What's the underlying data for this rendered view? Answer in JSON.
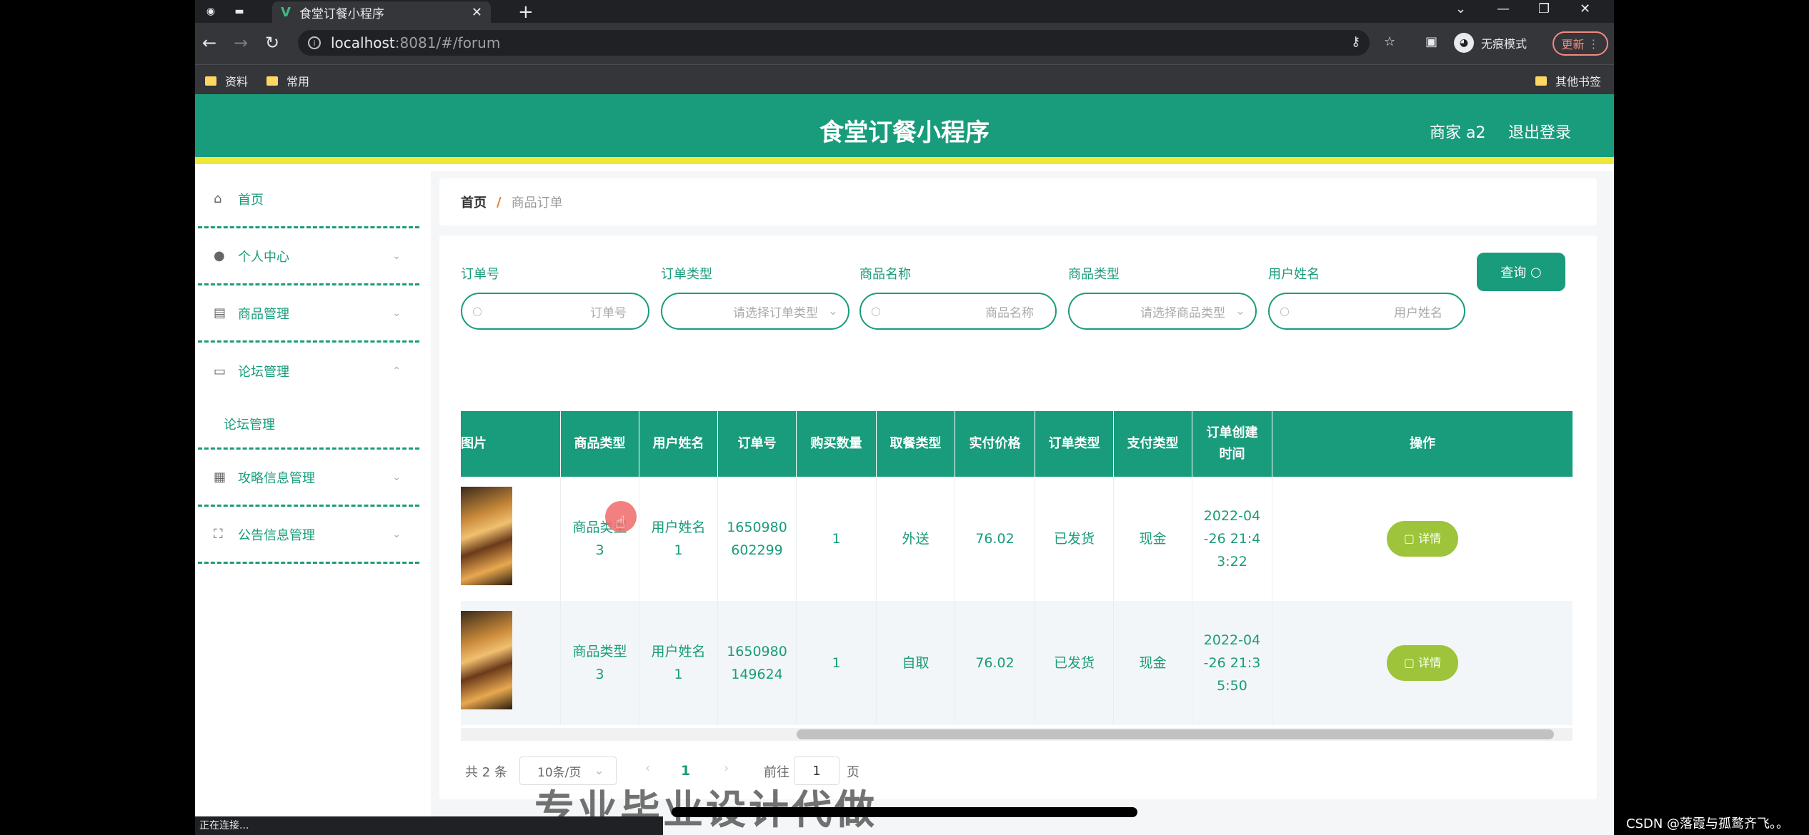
{
  "browser": {
    "tab_title": "食堂订餐小程序",
    "url_host": "localhost",
    "url_rest": ":8081/#/forum",
    "incognito": "无痕模式",
    "update": "更新",
    "bookmarks": [
      "资料",
      "常用"
    ],
    "other_bookmarks": "其他书签",
    "status": "正在连接..."
  },
  "header": {
    "title": "食堂订餐小程序",
    "user": "商家 a2",
    "logout": "退出登录"
  },
  "sidebar": {
    "items": [
      {
        "label": "首页",
        "icon": "home-icon"
      },
      {
        "label": "个人中心",
        "icon": "user-icon"
      },
      {
        "label": "商品管理",
        "icon": "briefcase-icon"
      },
      {
        "label": "论坛管理",
        "icon": "forum-icon"
      },
      {
        "label": "攻略信息管理",
        "icon": "clipboard-icon"
      },
      {
        "label": "公告信息管理",
        "icon": "scan-icon"
      }
    ],
    "sub_item": "论坛管理"
  },
  "breadcrumb": {
    "home": "首页",
    "sep": "/",
    "current": "商品订单"
  },
  "filters": [
    {
      "label": "订单号",
      "placeholder": "订单号"
    },
    {
      "label": "订单类型",
      "placeholder": "请选择订单类型"
    },
    {
      "label": "商品名称",
      "placeholder": "商品名称"
    },
    {
      "label": "商品类型",
      "placeholder": "请选择商品类型"
    },
    {
      "label": "用户姓名",
      "placeholder": "用户姓名"
    }
  ],
  "query_button": "查询",
  "table": {
    "headers": [
      "图片",
      "商品类型",
      "用户姓名",
      "订单号",
      "购买数量",
      "取餐类型",
      "实付价格",
      "订单类型",
      "支付类型",
      "订单创建时间",
      "操作"
    ],
    "rows": [
      {
        "cells": [
          "商品类型3",
          "用户姓名1",
          "1650980602299",
          "1",
          "外送",
          "76.02",
          "已发货",
          "现金",
          "2022-04-26 21:43:22"
        ],
        "action": "详情"
      },
      {
        "cells": [
          "商品类型3",
          "用户姓名1",
          "1650980149624",
          "1",
          "自取",
          "76.02",
          "已发货",
          "现金",
          "2022-04-26 21:35:50"
        ],
        "action": "详情"
      }
    ]
  },
  "pagination": {
    "total": "共 2 条",
    "page_size": "10条/页",
    "current_page": "1",
    "goto_label": "前往",
    "goto_value": "1",
    "page_suffix": "页"
  },
  "overlay": {
    "watermark": "专业毕业设计代做",
    "csdn": "CSDN @落霞与孤鹜齐飞。。"
  },
  "colors": {
    "primary": "#199c7b",
    "accent_bar": "#f0e839",
    "detail_button": "#9dc43a"
  }
}
